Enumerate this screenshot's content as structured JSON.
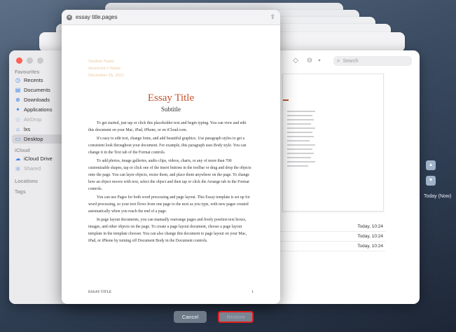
{
  "finder": {
    "sidebar": {
      "favourites_label": "Favourites",
      "icloud_label": "iCloud",
      "locations_label": "Locations",
      "tags_label": "Tags",
      "items": [
        {
          "label": "Recents",
          "icon": "clock-icon"
        },
        {
          "label": "Documents",
          "icon": "document-icon"
        },
        {
          "label": "Downloads",
          "icon": "download-icon"
        },
        {
          "label": "Applications",
          "icon": "applications-icon"
        },
        {
          "label": "AirDrop",
          "icon": "airdrop-icon"
        },
        {
          "label": "lxs",
          "icon": "home-icon"
        },
        {
          "label": "Desktop",
          "icon": "desktop-icon"
        },
        {
          "label": "iCloud Drive",
          "icon": "cloud-icon"
        },
        {
          "label": "Shared",
          "icon": "shared-folder-icon"
        }
      ]
    },
    "search_placeholder": "Search",
    "file_dates": [
      "Today, 10:24",
      "Today, 10:24",
      "Today, 10:24"
    ]
  },
  "document": {
    "window_title": "essay title.pages",
    "meta_lines": [
      "Student Name",
      "Instructor's Name",
      "December 28, 2022"
    ],
    "title": "Essay Title",
    "subtitle": "Subtitle",
    "paragraphs": [
      "To get started, just tap or click this placeholder text and begin typing. You can view and edit this document on your Mac, iPad, iPhone, or on iCloud.com.",
      "It's easy to edit text, change fonts, and add beautiful graphics. Use paragraph styles to get a consistent look throughout your document. For example, this paragraph uses Body style. You can change it in the Text tab of the Format controls.",
      "To add photos, image galleries, audio clips, videos, charts, or any of more than 700 customizable shapes, tap or click one of the insert buttons in the toolbar or drag and drop the objects onto the page. You can layer objects, resize them, and place them anywhere on the page. To change how an object moves with text, select the object and then tap or click the Arrange tab in the Format controls.",
      "You can use Pages for both word processing and page layout. This Essay template is set up for word processing, so your text flows from one page to the next as you type, with new pages created automatically when you reach the end of a page.",
      "In page layout documents, you can manually rearrange pages and freely position text boxes, images, and other objects on the page. To create a page layout document, choose a page layout template in the template chooser. You can also change this document to page layout on your Mac, iPad, or iPhone by turning off Document Body in the Document controls."
    ],
    "footer_left": "ESSAY TITLE",
    "footer_right": "1"
  },
  "timeline": {
    "label": "Today (Now)"
  },
  "buttons": {
    "cancel": "Cancel",
    "restore": "Restore"
  }
}
